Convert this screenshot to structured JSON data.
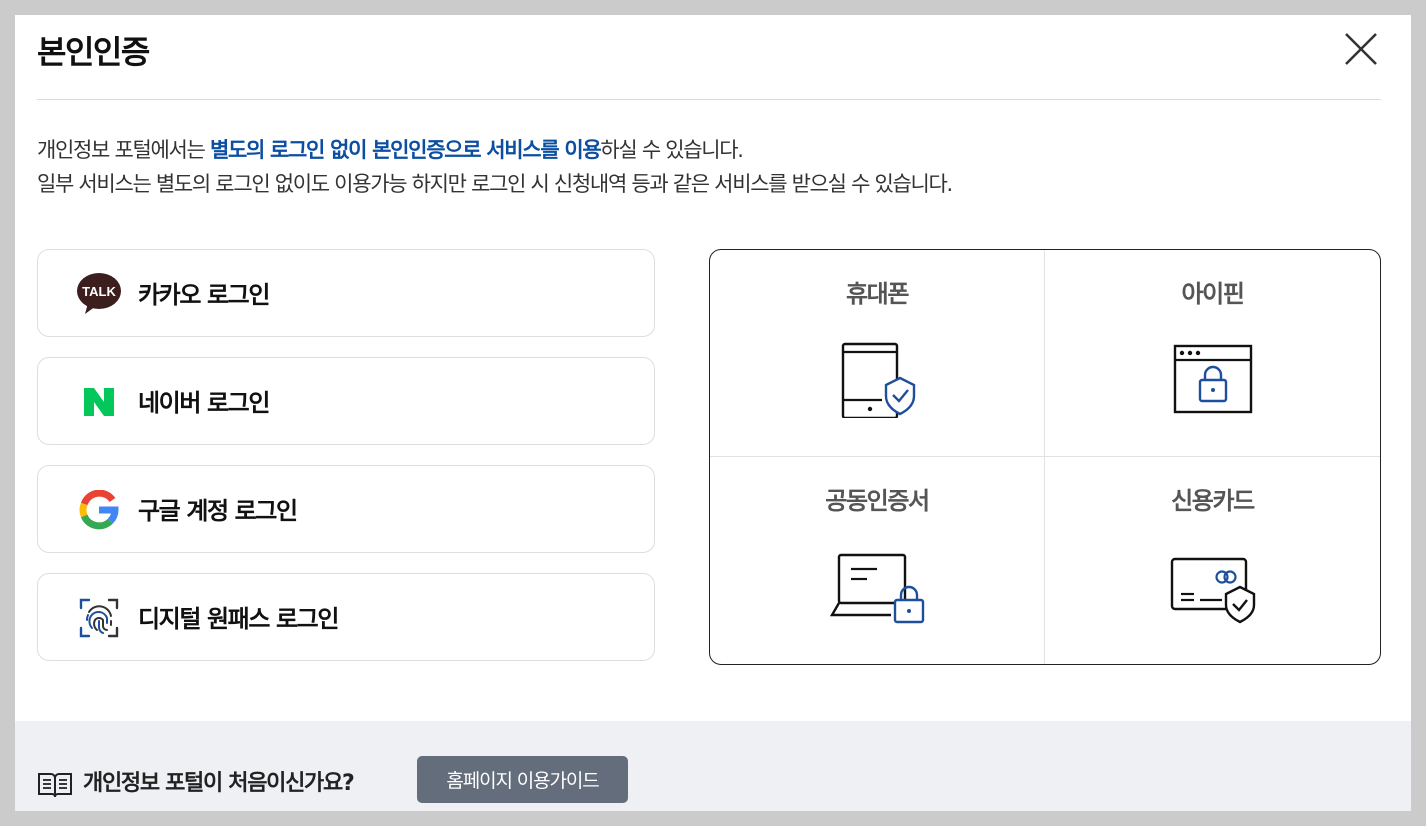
{
  "modal": {
    "title": "본인인증",
    "close_icon": "close-icon"
  },
  "description": {
    "line1_prefix": "개인정보 포털에서는 ",
    "line1_highlight": "별도의 로그인 없이 본인인증으로 서비스를 이용",
    "line1_suffix": "하실 수 있습니다.",
    "line2": "일부 서비스는 별도의 로그인 없이도 이용가능 하지만 로그인 시 신청내역 등과 같은 서비스를 받으실 수 있습니다."
  },
  "logins": [
    {
      "label": "카카오 로그인",
      "icon": "kakao-talk-icon",
      "icon_text": "TALK"
    },
    {
      "label": "네이버 로그인",
      "icon": "naver-icon"
    },
    {
      "label": "구글 계정 로그인",
      "icon": "google-icon"
    },
    {
      "label": "디지털 원패스 로그인",
      "icon": "fingerprint-icon"
    }
  ],
  "auth_methods": [
    {
      "label": "휴대폰",
      "icon": "phone-shield-icon"
    },
    {
      "label": "아이핀",
      "icon": "browser-lock-icon"
    },
    {
      "label": "공동인증서",
      "icon": "laptop-lock-icon"
    },
    {
      "label": "신용카드",
      "icon": "card-shield-icon"
    }
  ],
  "footer": {
    "question": "개인정보 포털이 처음이신가요?",
    "guide_button": "홈페이지 이용가이드",
    "icon": "book-icon"
  },
  "colors": {
    "accent": "#0b4ea2",
    "kakao_bubble": "#3c1e1e",
    "naver_green": "#03c75a",
    "guide_button_bg": "#646d7c",
    "footer_bg": "#eff0f4"
  }
}
